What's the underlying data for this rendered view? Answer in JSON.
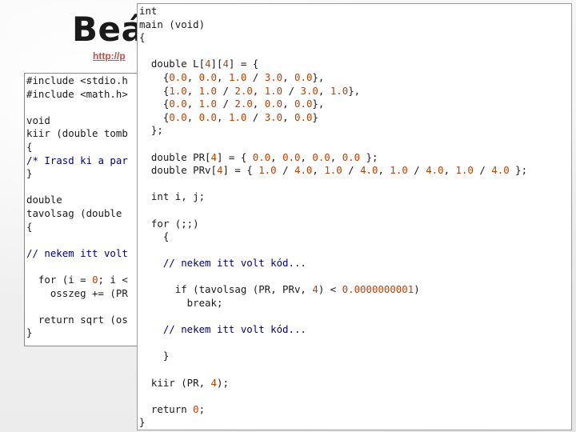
{
  "slide": {
    "title": "Beán",
    "link": "http://p"
  },
  "left_code": {
    "lines": [
      "#include <stdio.h",
      "#include <math.h>",
      "",
      "void",
      "kiir (double tomb",
      "{",
      "/* Irasd ki a par",
      "}",
      "",
      "double",
      "tavolsag (double",
      "{",
      "",
      "// nekem itt volt",
      "",
      "  for (i = 0; i <",
      "    osszeg += (PR",
      "",
      "  return sqrt (os",
      "}"
    ]
  },
  "right_code": {
    "lines": [
      "int",
      "main (void)",
      "{",
      "",
      "  double L[4][4] = {",
      "    {0.0, 0.0, 1.0 / 3.0, 0.0},",
      "    {1.0, 1.0 / 2.0, 1.0 / 3.0, 1.0},",
      "    {0.0, 1.0 / 2.0, 0.0, 0.0},",
      "    {0.0, 0.0, 1.0 / 3.0, 0.0}",
      "  };",
      "",
      "  double PR[4] = { 0.0, 0.0, 0.0, 0.0 };",
      "  double PRv[4] = { 1.0 / 4.0, 1.0 / 4.0, 1.0 / 4.0, 1.0 / 4.0 };",
      "",
      "  int i, j;",
      "",
      "  for (;;)",
      "    {",
      "",
      "    // nekem itt volt kód...",
      "",
      "      if (tavolsag (PR, PRv, 4) < 0.0000000001)",
      "        break;",
      "",
      "    // nekem itt volt kód...",
      "",
      "    }",
      "",
      "  kiir (PR, 4);",
      "",
      "  return 0;",
      "}"
    ]
  }
}
